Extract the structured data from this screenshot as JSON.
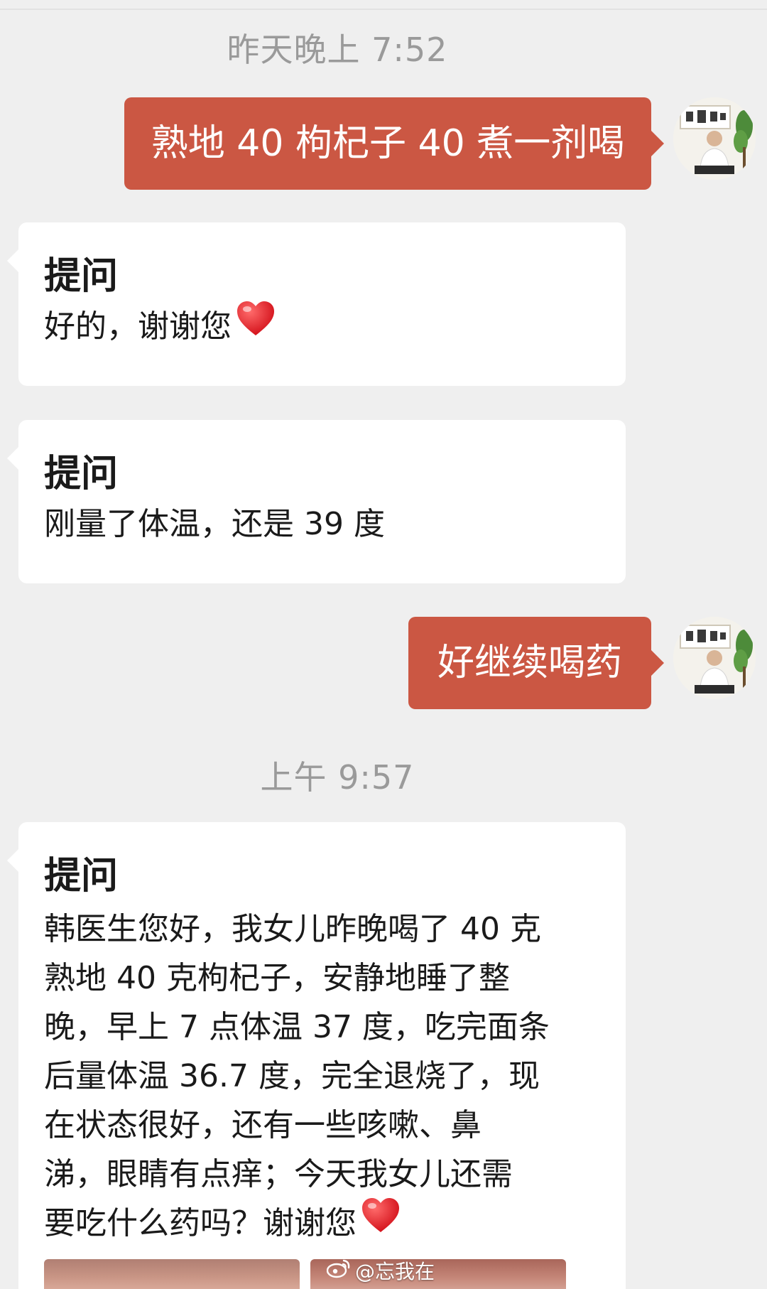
{
  "messages": [
    {
      "kind": "timestamp",
      "text": "昨天晚上 7:52"
    },
    {
      "kind": "outgoing",
      "text": "熟地 40 枸杞子 40 煮一剂喝"
    },
    {
      "kind": "incoming",
      "title": "提问",
      "text": "好的，谢谢您",
      "emoji": "heart"
    },
    {
      "kind": "incoming",
      "title": "提问",
      "text": "刚量了体温，还是 39 度"
    },
    {
      "kind": "outgoing",
      "text": "好继续喝药"
    },
    {
      "kind": "timestamp",
      "text": "上午 9:57"
    },
    {
      "kind": "incoming",
      "title": "提问",
      "lines": [
        "韩医生您好，我女儿昨晚喝了 40 克",
        "熟地 40 克枸杞子，安静地睡了整",
        "晚，早上 7 点体温 37 度，吃完面条",
        "后量体温 36.7 度，完全退烧了，现",
        "在状态很好，还有一些咳嗽、鼻",
        "涕，眼睛有点痒；今天我女儿还需",
        "要吃什么药吗？谢谢您"
      ],
      "emoji": "heart"
    }
  ],
  "watermark": {
    "text": "@忘我在",
    "icon": "weibo-icon"
  },
  "colors": {
    "background": "#efefef",
    "outgoing_bubble": "#cb5743",
    "incoming_bubble": "#ffffff",
    "timestamp_text": "#9a9a9a",
    "heart": "#e0242b"
  }
}
